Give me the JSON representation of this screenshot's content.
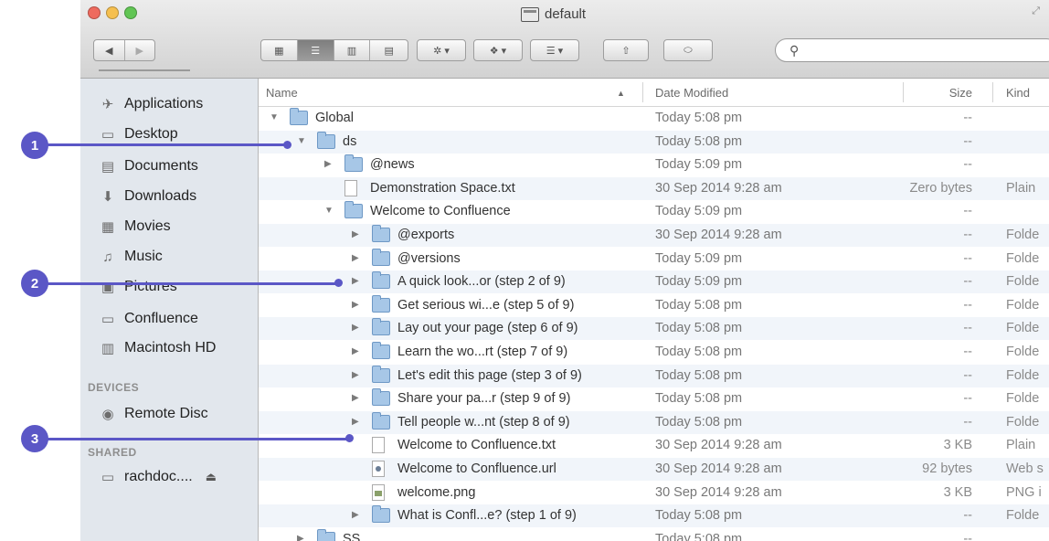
{
  "window": {
    "title": "default"
  },
  "toolbar": {
    "back": "◀",
    "forward": "▶"
  },
  "search": {
    "placeholder": ""
  },
  "sidebar": {
    "items": [
      {
        "label": "Applications",
        "icon": "applications-icon"
      },
      {
        "label": "Desktop",
        "icon": "desktop-icon"
      },
      {
        "label": "Documents",
        "icon": "documents-icon"
      },
      {
        "label": "Downloads",
        "icon": "downloads-icon"
      },
      {
        "label": "Movies",
        "icon": "movies-icon"
      },
      {
        "label": "Music",
        "icon": "music-icon"
      },
      {
        "label": "Pictures",
        "icon": "pictures-icon"
      },
      {
        "label": "Confluence",
        "icon": "folder-icon"
      },
      {
        "label": "Macintosh HD",
        "icon": "disk-icon"
      }
    ],
    "devices_heading": "DEVICES",
    "devices": [
      {
        "label": "Remote Disc",
        "icon": "disc-icon"
      }
    ],
    "shared_heading": "SHARED",
    "shared": [
      {
        "label": "rachdoc....",
        "icon": "network-icon"
      }
    ]
  },
  "columns": {
    "name": "Name",
    "date": "Date Modified",
    "size": "Size",
    "kind": "Kind"
  },
  "rows": [
    {
      "name": "Global",
      "date": "Today 5:08 pm",
      "size": "--",
      "kind": "",
      "type": "folder",
      "indent": 0,
      "expanded": true
    },
    {
      "name": "ds",
      "date": "Today 5:08 pm",
      "size": "--",
      "kind": "",
      "type": "folder",
      "indent": 1,
      "expanded": true
    },
    {
      "name": "@news",
      "date": "Today 5:09 pm",
      "size": "--",
      "kind": "",
      "type": "folder",
      "indent": 2,
      "expanded": false
    },
    {
      "name": "Demonstration Space.txt",
      "date": "30 Sep 2014 9:28 am",
      "size": "Zero bytes",
      "kind": "Plain",
      "type": "doc",
      "indent": 2
    },
    {
      "name": "Welcome to Confluence",
      "date": "Today 5:09 pm",
      "size": "--",
      "kind": "",
      "type": "folder",
      "indent": 2,
      "expanded": true
    },
    {
      "name": "@exports",
      "date": "30 Sep 2014 9:28 am",
      "size": "--",
      "kind": "Folde",
      "type": "folder",
      "indent": 3,
      "expanded": false
    },
    {
      "name": "@versions",
      "date": "Today 5:09 pm",
      "size": "--",
      "kind": "Folde",
      "type": "folder",
      "indent": 3,
      "expanded": false
    },
    {
      "name": "A quick look...or (step 2 of 9)",
      "date": "Today 5:09 pm",
      "size": "--",
      "kind": "Folde",
      "type": "folder",
      "indent": 3,
      "expanded": false
    },
    {
      "name": "Get serious wi...e (step 5 of 9)",
      "date": "Today 5:08 pm",
      "size": "--",
      "kind": "Folde",
      "type": "folder",
      "indent": 3,
      "expanded": false
    },
    {
      "name": "Lay out your page (step 6 of 9)",
      "date": "Today 5:08 pm",
      "size": "--",
      "kind": "Folde",
      "type": "folder",
      "indent": 3,
      "expanded": false
    },
    {
      "name": "Learn the wo...rt (step 7 of 9)",
      "date": "Today 5:08 pm",
      "size": "--",
      "kind": "Folde",
      "type": "folder",
      "indent": 3,
      "expanded": false
    },
    {
      "name": "Let's edit this page (step 3 of 9)",
      "date": "Today 5:08 pm",
      "size": "--",
      "kind": "Folde",
      "type": "folder",
      "indent": 3,
      "expanded": false
    },
    {
      "name": "Share your pa...r (step 9 of 9)",
      "date": "Today 5:08 pm",
      "size": "--",
      "kind": "Folde",
      "type": "folder",
      "indent": 3,
      "expanded": false
    },
    {
      "name": "Tell people w...nt (step 8 of 9)",
      "date": "Today 5:08 pm",
      "size": "--",
      "kind": "Folde",
      "type": "folder",
      "indent": 3,
      "expanded": false
    },
    {
      "name": "Welcome to Confluence.txt",
      "date": "30 Sep 2014 9:28 am",
      "size": "3 KB",
      "kind": "Plain",
      "type": "doc",
      "indent": 3
    },
    {
      "name": "Welcome to Confluence.url",
      "date": "30 Sep 2014 9:28 am",
      "size": "92 bytes",
      "kind": "Web s",
      "type": "webdoc",
      "indent": 3
    },
    {
      "name": "welcome.png",
      "date": "30 Sep 2014 9:28 am",
      "size": "3 KB",
      "kind": "PNG i",
      "type": "pngdoc",
      "indent": 3
    },
    {
      "name": "What is Confl...e? (step 1 of 9)",
      "date": "Today 5:08 pm",
      "size": "--",
      "kind": "Folde",
      "type": "folder",
      "indent": 3,
      "expanded": false
    },
    {
      "name": "SS",
      "date": "Today 5:08 pm",
      "size": "--",
      "kind": "",
      "type": "folder",
      "indent": 1,
      "expanded": false
    }
  ],
  "callouts": [
    {
      "number": "1"
    },
    {
      "number": "2"
    },
    {
      "number": "3"
    }
  ],
  "colors": {
    "callout": "#5b57c6",
    "sidebar": "#e2e7ed",
    "folder": "#a7c7e7"
  }
}
